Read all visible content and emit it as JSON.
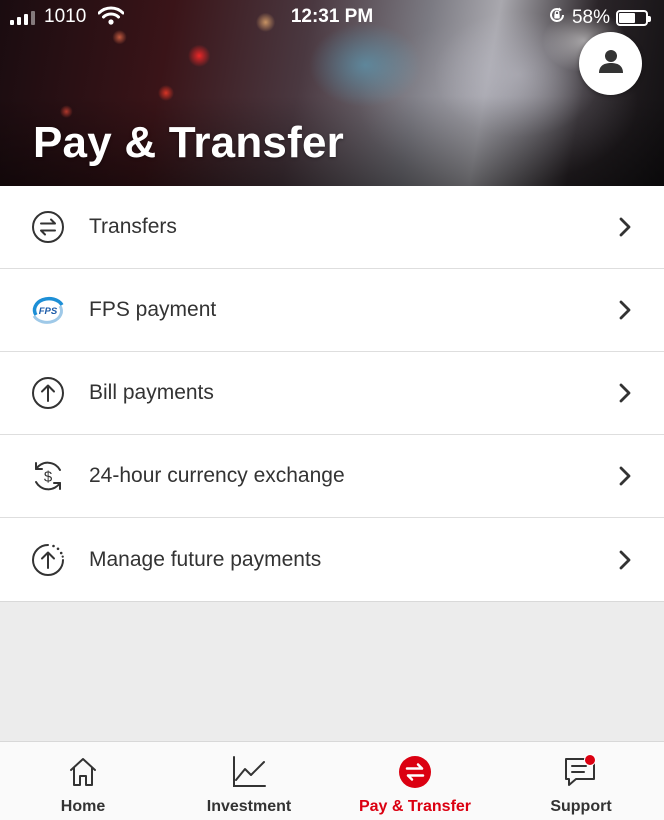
{
  "status_bar": {
    "carrier": "1010",
    "time": "12:31 PM",
    "battery": "58%",
    "battery_level": 0.58
  },
  "header": {
    "title": "Pay & Transfer"
  },
  "menu": {
    "items": [
      {
        "label": "Transfers",
        "icon": "transfer-arrows-icon"
      },
      {
        "label": "FPS payment",
        "icon": "fps-logo-icon",
        "logo_text": "FPS"
      },
      {
        "label": "Bill payments",
        "icon": "upload-arrow-icon"
      },
      {
        "label": "24-hour currency exchange",
        "icon": "currency-exchange-icon"
      },
      {
        "label": "Manage future payments",
        "icon": "scheduled-payment-icon"
      }
    ]
  },
  "tabs": [
    {
      "label": "Home",
      "icon": "home-icon",
      "active": false
    },
    {
      "label": "Investment",
      "icon": "chart-icon",
      "active": false
    },
    {
      "label": "Pay & Transfer",
      "icon": "transfer-icon",
      "active": true
    },
    {
      "label": "Support",
      "icon": "chat-icon",
      "active": false,
      "notification": true
    }
  ],
  "colors": {
    "brand_red": "#db0011",
    "text": "#333333",
    "background": "#ececec"
  }
}
